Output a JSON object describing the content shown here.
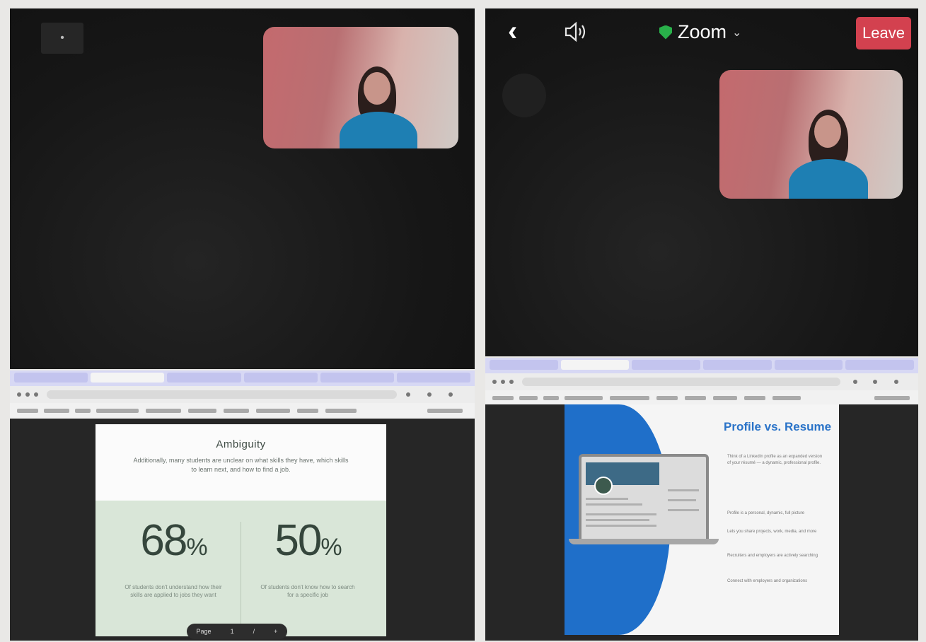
{
  "left_zoom": {
    "menu_icon": "ellipsis-icon",
    "participant": "woman-in-blue-top"
  },
  "right_zoom": {
    "back_icon": "chevron-left-icon",
    "back_glyph": "‹",
    "speaker_icon": "speaker-icon",
    "title": "Zoom",
    "title_dropdown_glyph": "⌄",
    "leave_label": "Leave",
    "colors": {
      "leave": "#d3414f",
      "shield": "#29b04a"
    }
  },
  "left_slide": {
    "title": "Ambiguity",
    "subtitle": "Additionally, many students are unclear on what skills they have, which skills to learn next, and how to find a job.",
    "stats": [
      {
        "value": "68",
        "unit": "%",
        "caption": "Of students don't understand how their skills are applied to jobs they want"
      },
      {
        "value": "50",
        "unit": "%",
        "caption": "Of students don't know how to search for a specific job"
      }
    ],
    "toolbar": {
      "page_label": "Page",
      "page_num": "1",
      "separator": "/",
      "zoom": "+"
    }
  },
  "right_slide": {
    "title": "Profile vs. Resume",
    "intro": "Think of a LinkedIn profile as an expanded version of your résumé — a dynamic, professional profile.",
    "bullets": [
      "Profile is a personal, dynamic, full picture",
      "Lets you share projects, work, media, and more",
      "Recruiters and employers are actively searching",
      "Connect with employers and organizations"
    ]
  }
}
